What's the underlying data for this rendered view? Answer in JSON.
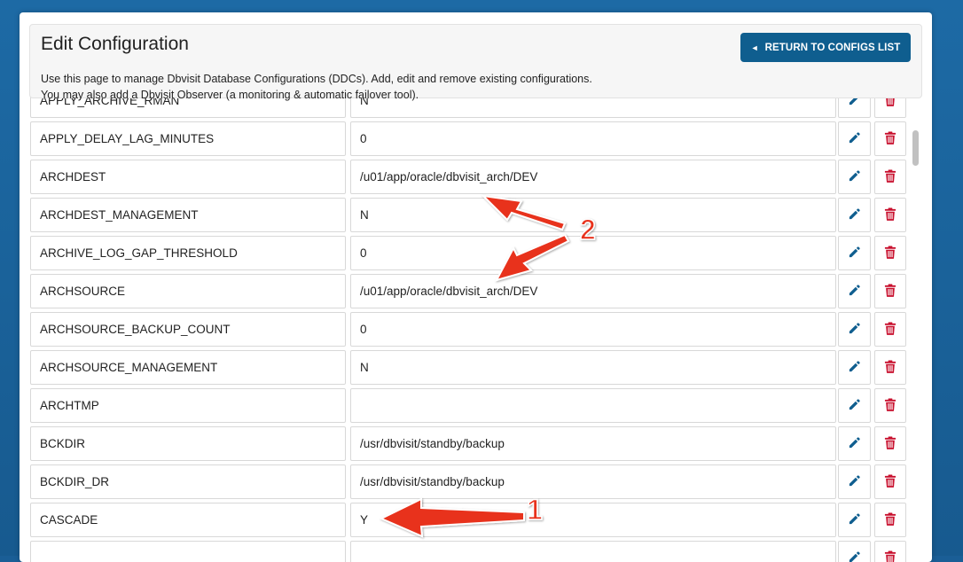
{
  "header": {
    "title": "Edit Configuration",
    "description_line1": "Use this page to manage Dbvisit Database Configurations (DDCs). Add, edit and remove existing configurations.",
    "description_line2": "You may also add a Dbvisit Observer (a monitoring & automatic failover tool).",
    "return_button": "RETURN TO CONFIGS LIST",
    "return_icon": "◄"
  },
  "rows": [
    {
      "name": "APPLY_ARCHIVE_RMAN",
      "value": "N"
    },
    {
      "name": "APPLY_DELAY_LAG_MINUTES",
      "value": "0"
    },
    {
      "name": "ARCHDEST",
      "value": "/u01/app/oracle/dbvisit_arch/DEV"
    },
    {
      "name": "ARCHDEST_MANAGEMENT",
      "value": "N"
    },
    {
      "name": "ARCHIVE_LOG_GAP_THRESHOLD",
      "value": "0"
    },
    {
      "name": "ARCHSOURCE",
      "value": "/u01/app/oracle/dbvisit_arch/DEV"
    },
    {
      "name": "ARCHSOURCE_BACKUP_COUNT",
      "value": "0"
    },
    {
      "name": "ARCHSOURCE_MANAGEMENT",
      "value": "N"
    },
    {
      "name": "ARCHTMP",
      "value": ""
    },
    {
      "name": "BCKDIR",
      "value": "/usr/dbvisit/standby/backup"
    },
    {
      "name": "BCKDIR_DR",
      "value": "/usr/dbvisit/standby/backup"
    },
    {
      "name": "CASCADE",
      "value": "Y"
    },
    {
      "name": "",
      "value": ""
    }
  ],
  "icons": {
    "edit": "pencil-icon",
    "delete": "trash-icon"
  },
  "annotations": {
    "label1": "1",
    "label2": "2"
  },
  "colors": {
    "primary": "#0f5e8f",
    "delete": "#c8102e",
    "annotation": "#e8321e"
  }
}
